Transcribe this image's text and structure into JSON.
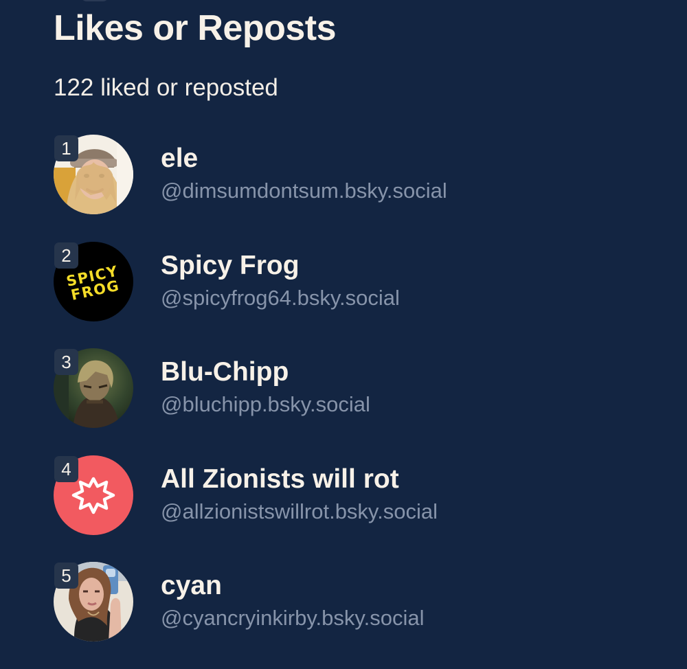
{
  "page": {
    "title": "Likes or Reposts",
    "subtitle": "122 liked or reposted"
  },
  "users": [
    {
      "rank": "1",
      "name": "ele",
      "handle": "@dimsumdontsum.bsky.social",
      "avatar": "photo-avatar"
    },
    {
      "rank": "2",
      "name": "Spicy Frog",
      "handle": "@spicyfrog64.bsky.social",
      "avatar": "text-logo-avatar",
      "avatar_text": [
        "SPICY",
        "FROG"
      ]
    },
    {
      "rank": "3",
      "name": "Blu-Chipp",
      "handle": "@bluchipp.bsky.social",
      "avatar": "photo-avatar"
    },
    {
      "rank": "4",
      "name": "All Zionists will rot",
      "handle": "@allzionistswillrot.bsky.social",
      "avatar": "default-star-avatar"
    },
    {
      "rank": "5",
      "name": "cyan",
      "handle": "@cyancryinkirby.bsky.social",
      "avatar": "photo-avatar"
    }
  ],
  "colors": {
    "background": "#132542",
    "text_primary": "#f7f1e8",
    "text_secondary": "#8794aa",
    "rank_badge": "#26354c",
    "default_avatar": "#f25a60",
    "logo_yellow": "#f4dc28"
  }
}
